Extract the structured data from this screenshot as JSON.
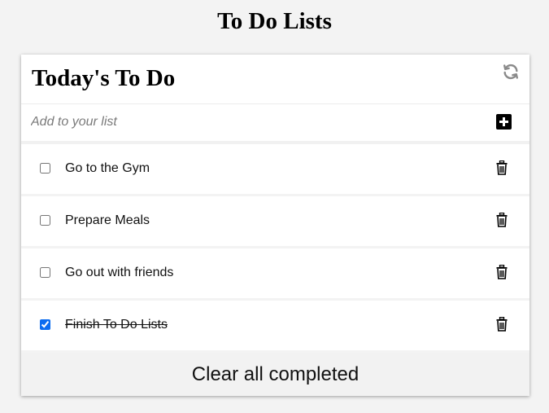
{
  "page": {
    "title": "To Do Lists"
  },
  "card": {
    "title": "Today's To Do",
    "add_placeholder": "Add to your list",
    "add_value": ""
  },
  "todos": [
    {
      "label": "Go to the Gym",
      "completed": false
    },
    {
      "label": "Prepare Meals",
      "completed": false
    },
    {
      "label": "Go out with friends",
      "completed": false
    },
    {
      "label": "Finish To Do Lists",
      "completed": true
    }
  ],
  "footer": {
    "clear_label": "Clear all completed"
  },
  "icons": {
    "refresh": "refresh-icon",
    "add": "plus-square-icon",
    "delete": "trash-icon"
  },
  "colors": {
    "checkbox_accent": "#0b6cf0",
    "icon_gray": "#8a8a8a"
  }
}
